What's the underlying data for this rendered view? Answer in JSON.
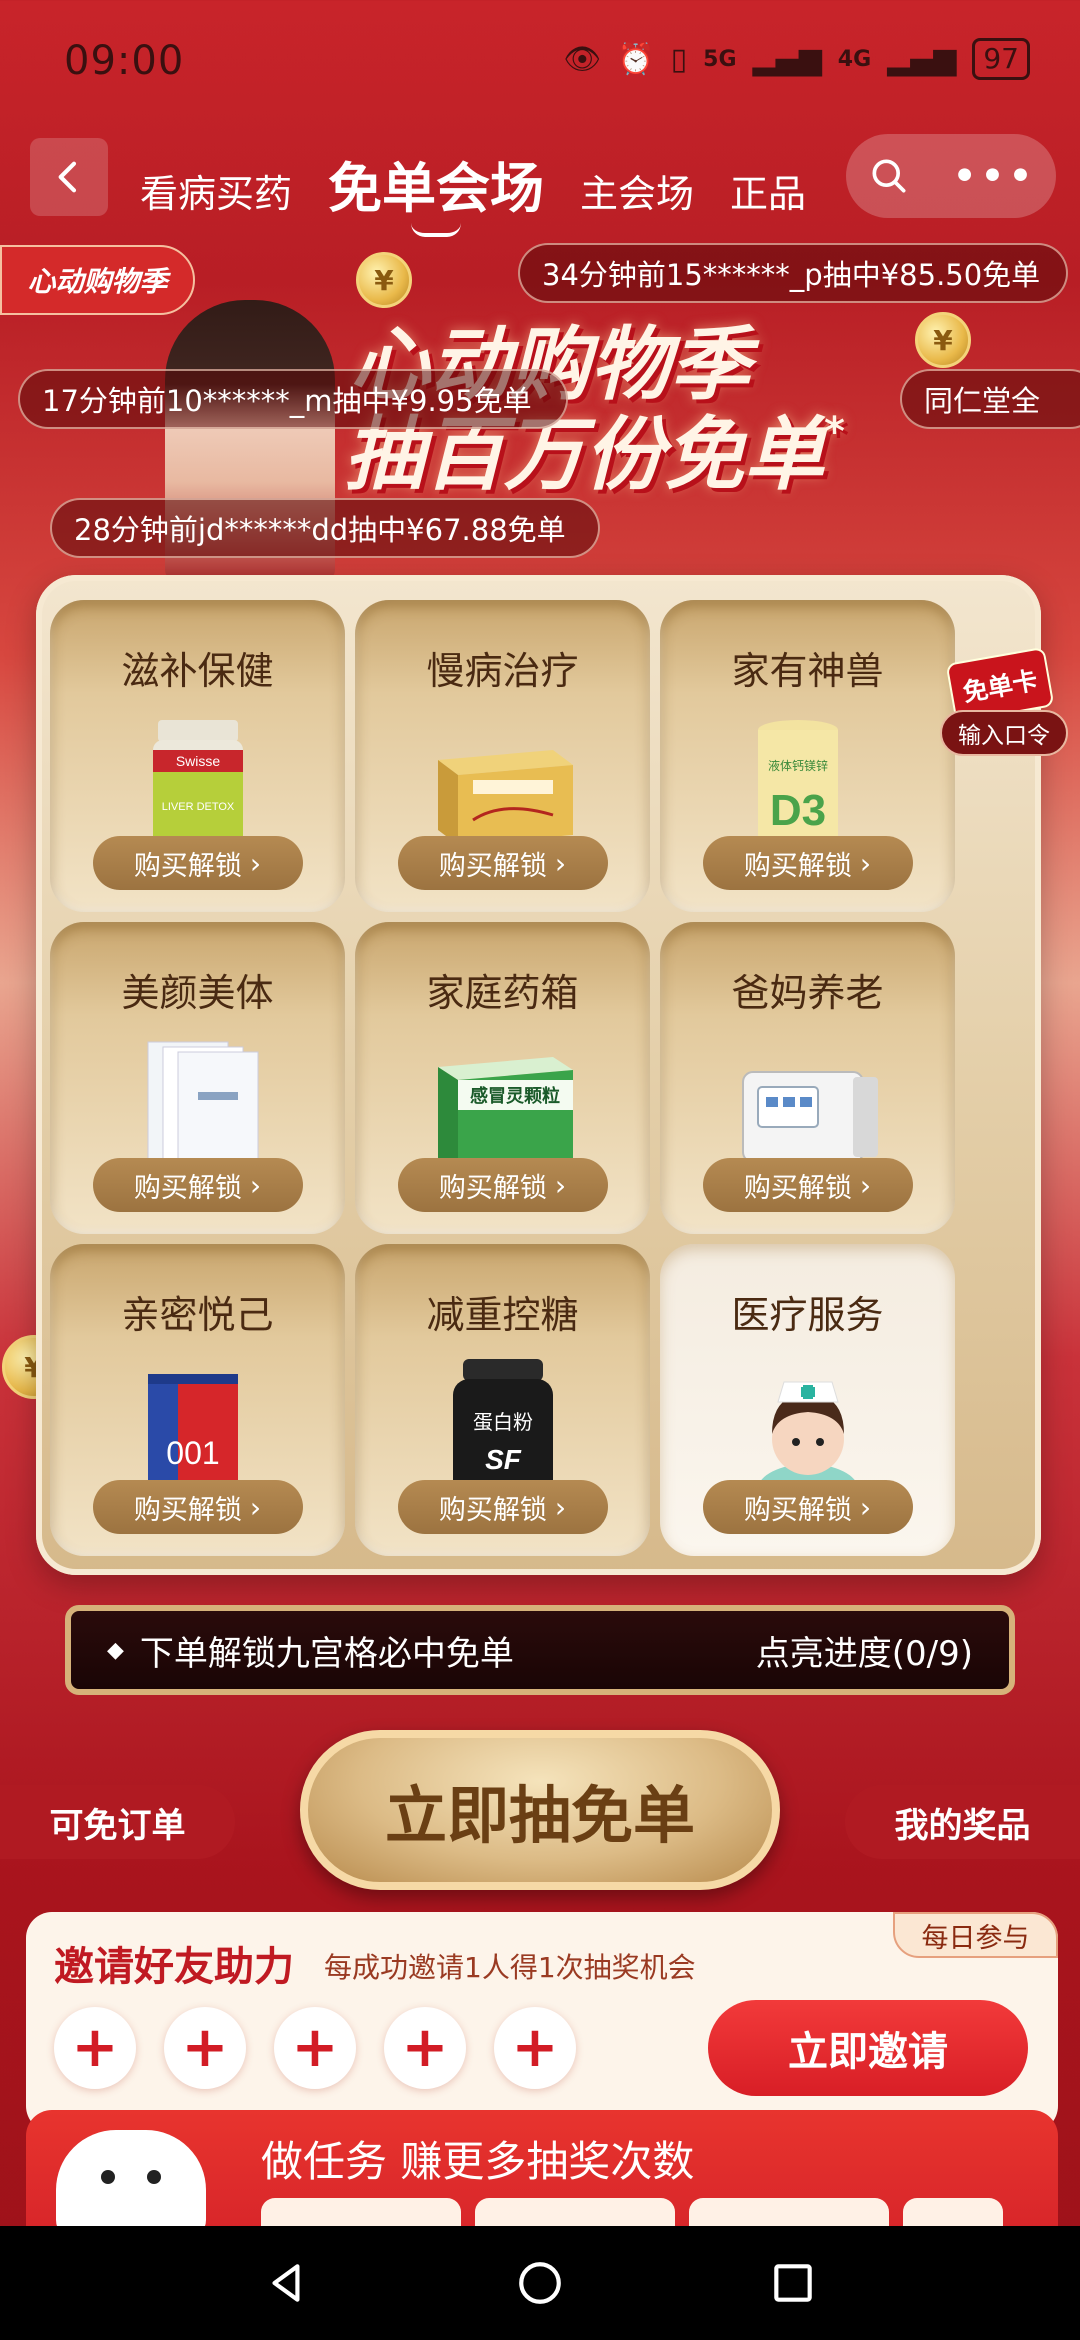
{
  "status": {
    "time": "09:00",
    "battery": "97",
    "network1": "5G",
    "network2": "4G"
  },
  "nav": {
    "tabs": [
      {
        "label": "看病买药"
      },
      {
        "label": "免单会场"
      },
      {
        "label": "主会场"
      },
      {
        "label": "正品"
      }
    ]
  },
  "banner": {
    "badge": "心动购物季",
    "title_line1": "心动购物季",
    "title_line2": "抽百万份免单",
    "asterisk": "*",
    "tickers": [
      "34分钟前15******_p抽中¥85.50免单",
      "17分钟前10******_m抽中¥9.95免单",
      "28分钟前jd******dd抽中¥67.88免单",
      "同仁堂全"
    ]
  },
  "grid": {
    "cells": [
      {
        "label": "滋补保健",
        "button": "购买解锁"
      },
      {
        "label": "慢病治疗",
        "button": "购买解锁"
      },
      {
        "label": "家有神兽",
        "button": "购买解锁"
      },
      {
        "label": "美颜美体",
        "button": "购买解锁"
      },
      {
        "label": "家庭药箱",
        "button": "购买解锁"
      },
      {
        "label": "爸妈养老",
        "button": "购买解锁"
      },
      {
        "label": "亲密悦己",
        "button": "购买解锁"
      },
      {
        "label": "减重控糖",
        "button": "购买解锁"
      },
      {
        "label": "医疗服务",
        "button": "购买解锁"
      }
    ],
    "free_card": "免单卡",
    "code_button": "输入口令",
    "product_texts": {
      "swisse": "Swisse",
      "swisse_sub": "LIVER DETOX",
      "d3": "D3",
      "d3_label": "液体钙镁锌",
      "cold_med": "感冒灵颗粒",
      "condom": "001",
      "protein": "蛋白粉",
      "protein_sub": "SF"
    }
  },
  "progress": {
    "left": "下单解锁九宫格必中免单",
    "right": "点亮进度(0/9)"
  },
  "draw": {
    "left_pill": "可免订单",
    "button": "立即抽免单",
    "right_pill": "我的奖品"
  },
  "invite": {
    "tag": "每日参与",
    "title": "邀请好友助力",
    "subtitle": "每成功邀请1人得1次抽奖机会",
    "plus": "+",
    "button": "立即邀请"
  },
  "task": {
    "title": "做任务 赚更多抽奖次数"
  },
  "colors": {
    "accent_red": "#d21c25",
    "gold": "#d6b27a",
    "brown_text": "#4a2a12"
  }
}
